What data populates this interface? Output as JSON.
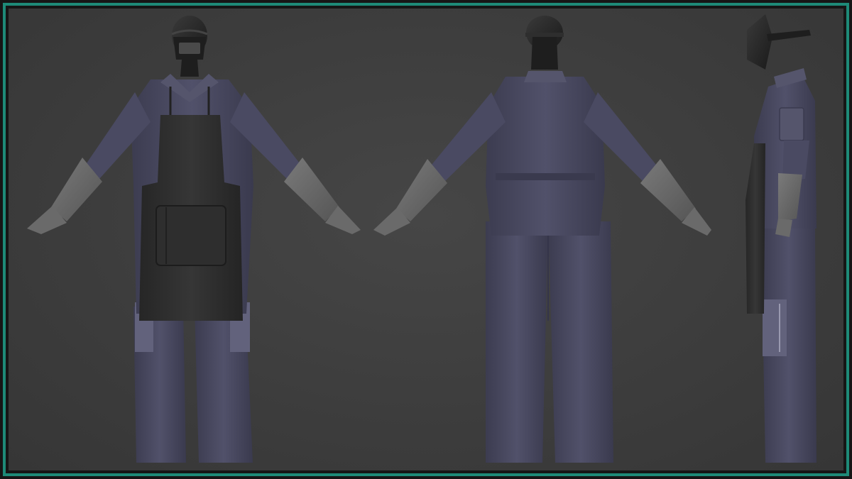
{
  "scene": {
    "subject": "welder-outfit-3d-turnaround",
    "views": [
      {
        "id": "front"
      },
      {
        "id": "back"
      },
      {
        "id": "side"
      }
    ],
    "colors": {
      "frame_border": "#1e8a78",
      "background": "#3f3f3f",
      "coverall": "#4a4a60",
      "coverall_shadow": "#3a3a4e",
      "coverall_light": "#5a5a72",
      "apron": "#2c2c2c",
      "apron_light": "#3a3a3a",
      "glove": "#6a6a6a",
      "helmet": "#262626",
      "skin_mannequin": "#2a2a2a",
      "knee_patch": "#62627c"
    }
  }
}
